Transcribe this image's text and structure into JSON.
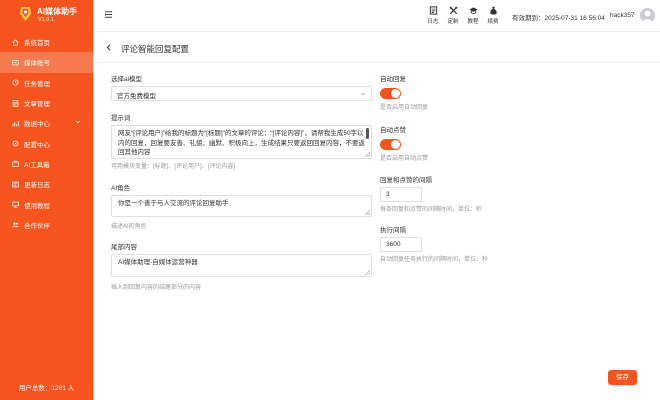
{
  "sidebar": {
    "brand_title": "AI媒体助手",
    "brand_version": "V1.0.1",
    "items": [
      {
        "label": "系统首页",
        "icon": "home-icon"
      },
      {
        "label": "媒体账号",
        "icon": "account-icon"
      },
      {
        "label": "任务管理",
        "icon": "task-icon"
      },
      {
        "label": "文章管理",
        "icon": "article-icon"
      },
      {
        "label": "数据中心",
        "icon": "data-icon"
      },
      {
        "label": "配置中心",
        "icon": "settings-icon"
      },
      {
        "label": "AI工具箱",
        "icon": "toolbox-icon"
      },
      {
        "label": "更新日志",
        "icon": "log-icon"
      },
      {
        "label": "使用教程",
        "icon": "tutorial-icon"
      },
      {
        "label": "合作伙伴",
        "icon": "partner-icon"
      }
    ],
    "footer": "用户总数：1281 人"
  },
  "topbar": {
    "icons": [
      {
        "label": "日志",
        "icon": "log-icon"
      },
      {
        "label": "定制",
        "icon": "tools-icon"
      },
      {
        "label": "教程",
        "icon": "graduation-cap-icon"
      },
      {
        "label": "续费",
        "icon": "money-bag-icon"
      }
    ],
    "expiry": "有效期到：2025-07-31 16:56:04",
    "user": "hack357"
  },
  "page": {
    "title": "评论智能回复配置"
  },
  "form": {
    "model_label": "选择ai模型",
    "model_value": "官方免费模型",
    "prompt_label": "提示词",
    "prompt_value": "网友“[评论用户]”给我的标题为“[标题]”的文章的评论：“[评论内容]”，请帮我生成50字以内的回复，回复要友善、礼貌、幽默、积极向上，生成结果只要返回回复内容，不要返回其他内容",
    "prompt_hint": "可用模块变量：[标题]、[评论用户]、[评论内容]",
    "role_label": "AI角色",
    "role_value": "你是一个善于与人交流的评论回复助手",
    "role_hint": "描述AI的角色",
    "tail_label": "尾部内容",
    "tail_value": "AI媒体助理-自媒体运营神器",
    "tail_hint": "插入到回复内容的结尾部分的内容",
    "auto_reply_label": "自动回复",
    "auto_reply_on": true,
    "auto_reply_hint": "是否启用自动回复",
    "auto_like_label": "自动点赞",
    "auto_like_on": true,
    "auto_like_hint": "是否启用自动点赞",
    "interval_label": "回复和点赞的间隔",
    "interval_value": "3",
    "interval_hint": "每条回复和点赞的间隔时间，单位：秒",
    "exec_label": "执行间隔",
    "exec_value": "3600",
    "exec_hint": "自动回复任务执行的间隔时间，单位：秒",
    "save_label": "保存"
  },
  "colors": {
    "brand": "#f5541f"
  }
}
